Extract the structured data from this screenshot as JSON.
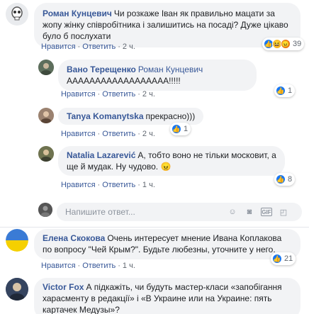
{
  "comments": [
    {
      "author": "Роман Кунцевич",
      "text": "Чи розкаже Іван як правильно мацати за жопу жінку співробітника і залишитись на посаді? Дуже цікаво було б послухати",
      "like_label": "Нравится",
      "reply_label": "Ответить",
      "time": "2 ч.",
      "reactions_count": "39"
    },
    {
      "author": "Вано Терещенко",
      "mention": "Роман Кунцевич",
      "text": "АААААААААААААААААА!!!!!",
      "like_label": "Нравится",
      "reply_label": "Ответить",
      "time": "2 ч.",
      "reactions_count": "1"
    },
    {
      "author": "Tanya Komanytska",
      "text": "прекрасно)))",
      "like_label": "Нравится",
      "reply_label": "Ответить",
      "time": "2 ч.",
      "reactions_count": "1"
    },
    {
      "author": "Natalia Lazarević",
      "text": "А, тобто воно не тільки московит, а ще й мудак. Ну чудово. 😠",
      "like_label": "Нравится",
      "reply_label": "Ответить",
      "time": "1 ч.",
      "reactions_count": "8"
    },
    {
      "author": "Елена Скокова",
      "text": "Очень интересует мнение Ивана Коплакова по вопросу \"Чей Крым?\". Будьте любезны, уточните у него.",
      "like_label": "Нравится",
      "reply_label": "Ответить",
      "time": "1 ч.",
      "reactions_count": "21"
    },
    {
      "author": "Victor Fox",
      "text": "А підкажіть, чи будуть мастер-класи «запобігання харасменту в редакції» і «В Украине или на Украине: пять картачек Медузы»?"
    }
  ],
  "reply_input": {
    "placeholder": "Напишите ответ..."
  },
  "colors": {
    "link": "#385898",
    "bubble": "#f2f3f5",
    "like": "#1877f2"
  }
}
